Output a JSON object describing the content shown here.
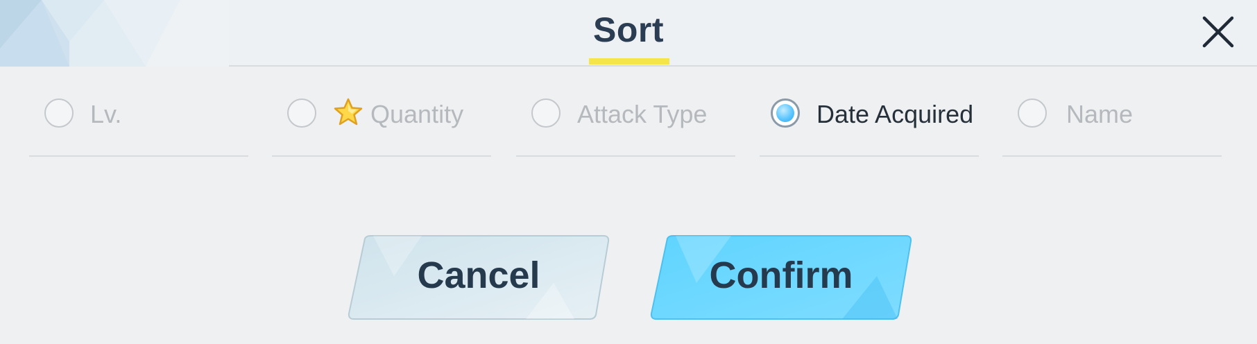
{
  "dialog": {
    "title": "Sort",
    "close_icon": "close-icon"
  },
  "options": [
    {
      "label": "Lv.",
      "checked": false
    },
    {
      "label": "Quantity",
      "checked": false,
      "icon": "star-icon"
    },
    {
      "label": "Attack Type",
      "checked": false
    },
    {
      "label": "Date Acquired",
      "checked": true
    },
    {
      "label": "Name",
      "checked": false
    }
  ],
  "buttons": {
    "cancel_label": "Cancel",
    "confirm_label": "Confirm"
  },
  "colors": {
    "title": "#2b3d52",
    "title_underline": "#f5e44a",
    "cancel_bg": "#d7e8f0",
    "confirm_bg": "#6bd8ff",
    "radio_selected": "#4fbff8",
    "inactive_text": "#b5b9bd",
    "active_text": "#26303a"
  }
}
